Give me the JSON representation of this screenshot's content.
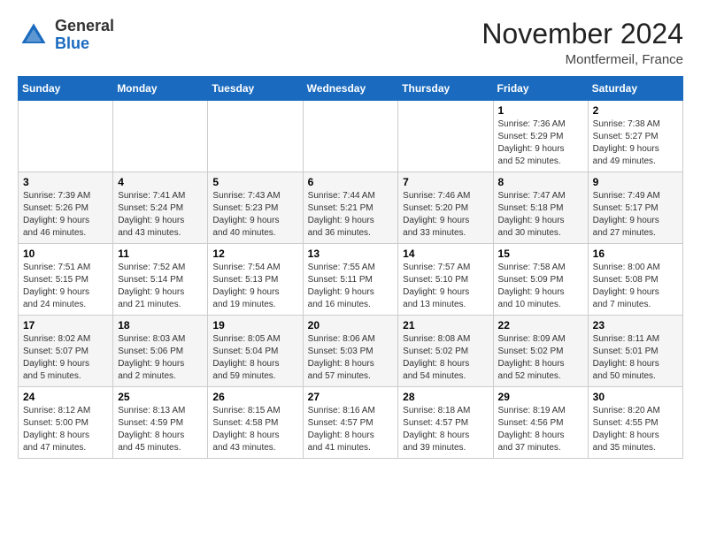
{
  "logo": {
    "general": "General",
    "blue": "Blue"
  },
  "header": {
    "month": "November 2024",
    "location": "Montfermeil, France"
  },
  "days_of_week": [
    "Sunday",
    "Monday",
    "Tuesday",
    "Wednesday",
    "Thursday",
    "Friday",
    "Saturday"
  ],
  "weeks": [
    {
      "days": [
        {
          "num": "",
          "info": ""
        },
        {
          "num": "",
          "info": ""
        },
        {
          "num": "",
          "info": ""
        },
        {
          "num": "",
          "info": ""
        },
        {
          "num": "",
          "info": ""
        },
        {
          "num": "1",
          "info": "Sunrise: 7:36 AM\nSunset: 5:29 PM\nDaylight: 9 hours\nand 52 minutes."
        },
        {
          "num": "2",
          "info": "Sunrise: 7:38 AM\nSunset: 5:27 PM\nDaylight: 9 hours\nand 49 minutes."
        }
      ]
    },
    {
      "days": [
        {
          "num": "3",
          "info": "Sunrise: 7:39 AM\nSunset: 5:26 PM\nDaylight: 9 hours\nand 46 minutes."
        },
        {
          "num": "4",
          "info": "Sunrise: 7:41 AM\nSunset: 5:24 PM\nDaylight: 9 hours\nand 43 minutes."
        },
        {
          "num": "5",
          "info": "Sunrise: 7:43 AM\nSunset: 5:23 PM\nDaylight: 9 hours\nand 40 minutes."
        },
        {
          "num": "6",
          "info": "Sunrise: 7:44 AM\nSunset: 5:21 PM\nDaylight: 9 hours\nand 36 minutes."
        },
        {
          "num": "7",
          "info": "Sunrise: 7:46 AM\nSunset: 5:20 PM\nDaylight: 9 hours\nand 33 minutes."
        },
        {
          "num": "8",
          "info": "Sunrise: 7:47 AM\nSunset: 5:18 PM\nDaylight: 9 hours\nand 30 minutes."
        },
        {
          "num": "9",
          "info": "Sunrise: 7:49 AM\nSunset: 5:17 PM\nDaylight: 9 hours\nand 27 minutes."
        }
      ]
    },
    {
      "days": [
        {
          "num": "10",
          "info": "Sunrise: 7:51 AM\nSunset: 5:15 PM\nDaylight: 9 hours\nand 24 minutes."
        },
        {
          "num": "11",
          "info": "Sunrise: 7:52 AM\nSunset: 5:14 PM\nDaylight: 9 hours\nand 21 minutes."
        },
        {
          "num": "12",
          "info": "Sunrise: 7:54 AM\nSunset: 5:13 PM\nDaylight: 9 hours\nand 19 minutes."
        },
        {
          "num": "13",
          "info": "Sunrise: 7:55 AM\nSunset: 5:11 PM\nDaylight: 9 hours\nand 16 minutes."
        },
        {
          "num": "14",
          "info": "Sunrise: 7:57 AM\nSunset: 5:10 PM\nDaylight: 9 hours\nand 13 minutes."
        },
        {
          "num": "15",
          "info": "Sunrise: 7:58 AM\nSunset: 5:09 PM\nDaylight: 9 hours\nand 10 minutes."
        },
        {
          "num": "16",
          "info": "Sunrise: 8:00 AM\nSunset: 5:08 PM\nDaylight: 9 hours\nand 7 minutes."
        }
      ]
    },
    {
      "days": [
        {
          "num": "17",
          "info": "Sunrise: 8:02 AM\nSunset: 5:07 PM\nDaylight: 9 hours\nand 5 minutes."
        },
        {
          "num": "18",
          "info": "Sunrise: 8:03 AM\nSunset: 5:06 PM\nDaylight: 9 hours\nand 2 minutes."
        },
        {
          "num": "19",
          "info": "Sunrise: 8:05 AM\nSunset: 5:04 PM\nDaylight: 8 hours\nand 59 minutes."
        },
        {
          "num": "20",
          "info": "Sunrise: 8:06 AM\nSunset: 5:03 PM\nDaylight: 8 hours\nand 57 minutes."
        },
        {
          "num": "21",
          "info": "Sunrise: 8:08 AM\nSunset: 5:02 PM\nDaylight: 8 hours\nand 54 minutes."
        },
        {
          "num": "22",
          "info": "Sunrise: 8:09 AM\nSunset: 5:02 PM\nDaylight: 8 hours\nand 52 minutes."
        },
        {
          "num": "23",
          "info": "Sunrise: 8:11 AM\nSunset: 5:01 PM\nDaylight: 8 hours\nand 50 minutes."
        }
      ]
    },
    {
      "days": [
        {
          "num": "24",
          "info": "Sunrise: 8:12 AM\nSunset: 5:00 PM\nDaylight: 8 hours\nand 47 minutes."
        },
        {
          "num": "25",
          "info": "Sunrise: 8:13 AM\nSunset: 4:59 PM\nDaylight: 8 hours\nand 45 minutes."
        },
        {
          "num": "26",
          "info": "Sunrise: 8:15 AM\nSunset: 4:58 PM\nDaylight: 8 hours\nand 43 minutes."
        },
        {
          "num": "27",
          "info": "Sunrise: 8:16 AM\nSunset: 4:57 PM\nDaylight: 8 hours\nand 41 minutes."
        },
        {
          "num": "28",
          "info": "Sunrise: 8:18 AM\nSunset: 4:57 PM\nDaylight: 8 hours\nand 39 minutes."
        },
        {
          "num": "29",
          "info": "Sunrise: 8:19 AM\nSunset: 4:56 PM\nDaylight: 8 hours\nand 37 minutes."
        },
        {
          "num": "30",
          "info": "Sunrise: 8:20 AM\nSunset: 4:55 PM\nDaylight: 8 hours\nand 35 minutes."
        }
      ]
    }
  ]
}
